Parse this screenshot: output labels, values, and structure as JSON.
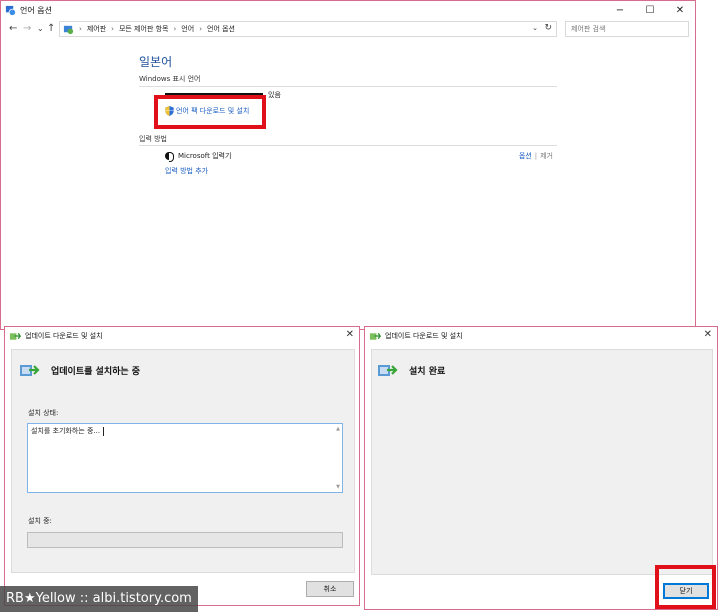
{
  "main_window": {
    "title": "언어 옵션",
    "controls": {
      "minimize": "−",
      "maximize": "☐",
      "close": "✕"
    },
    "nav": {
      "back": "←",
      "forward": "→",
      "dropdown": "⌄",
      "up": "↑"
    },
    "breadcrumb": [
      "제어판",
      "모든 제어판 항목",
      "언어",
      "언어 옵션"
    ],
    "breadcrumb_sep": "›",
    "search_placeholder": "제어판 검색",
    "language_title": "일본어",
    "display_lang_label": "Windows 표시 언어",
    "display_lang_status_suffix": "있음",
    "download_link": "언어 팩 다운로드 및 설치",
    "input_method_label": "입력 방법",
    "ime_name": "Microsoft 입력기",
    "ime_options": "옵션",
    "ime_remove": "제거",
    "add_input_method": "입력 방법 추가"
  },
  "dialog_installing": {
    "title": "업데이트 다운로드 및 설치",
    "heading": "업데이트를 설치하는 중",
    "status_label": "설치 상태:",
    "status_text": "설치를 초기화하는 중...",
    "progress_label": "설치 중:",
    "progress": 0,
    "cancel_button": "취소"
  },
  "dialog_complete": {
    "title": "업데이트 다운로드 및 설치",
    "heading": "설치 완료",
    "close_button": "닫기"
  },
  "watermark": "RB★Yellow :: albi.tistory.com",
  "colors": {
    "link": "#1a5cc2",
    "highlight": "#e0101b",
    "window_border": "#d76c8c"
  }
}
